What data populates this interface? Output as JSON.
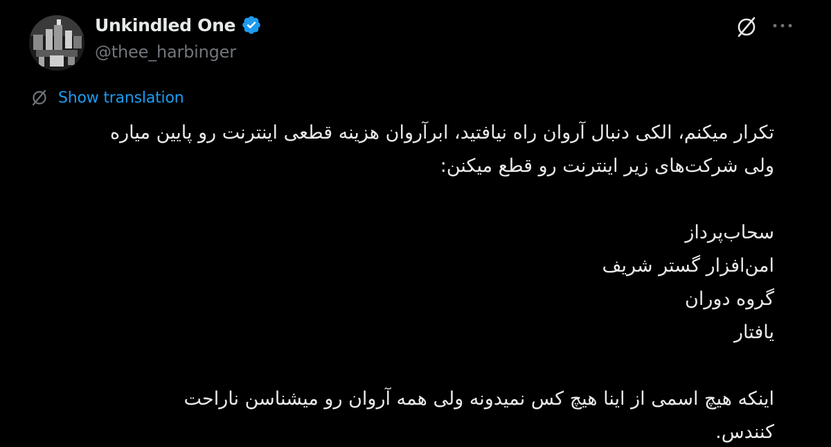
{
  "author": {
    "display_name": "Unkindled One",
    "handle": "@thee_harbinger",
    "verified": true,
    "verified_color": "#1d9bf0"
  },
  "actions": {
    "grok_icon": "grok-slash-icon",
    "more_icon": "more-dots-icon"
  },
  "translation": {
    "label": "Show translation",
    "icon": "grok-slash-icon",
    "color": "#1d9bf0"
  },
  "body": {
    "line1": "تکرار میکنم، الکی دنبال آروان راه نیافتید، ابرآروان هزینه قطعی اینترنت رو پایین میاره",
    "line2": "ولی شرکت‌های زیر اینترنت رو قطع میکنن:",
    "company1": "سحاب‌پرداز",
    "company2": "امن‌افزار گستر شریف",
    "company3": "گروه دوران",
    "company4": "یافتار",
    "closing1": "اینکه هیچ اسمی از اینا هیچ کس نمیدونه ولی همه آروان رو میشناسن ناراحت",
    "closing2": "کنندس."
  },
  "colors": {
    "background": "#000000",
    "text": "#e7e9ea",
    "secondary": "#71767b",
    "accent": "#1d9bf0"
  }
}
